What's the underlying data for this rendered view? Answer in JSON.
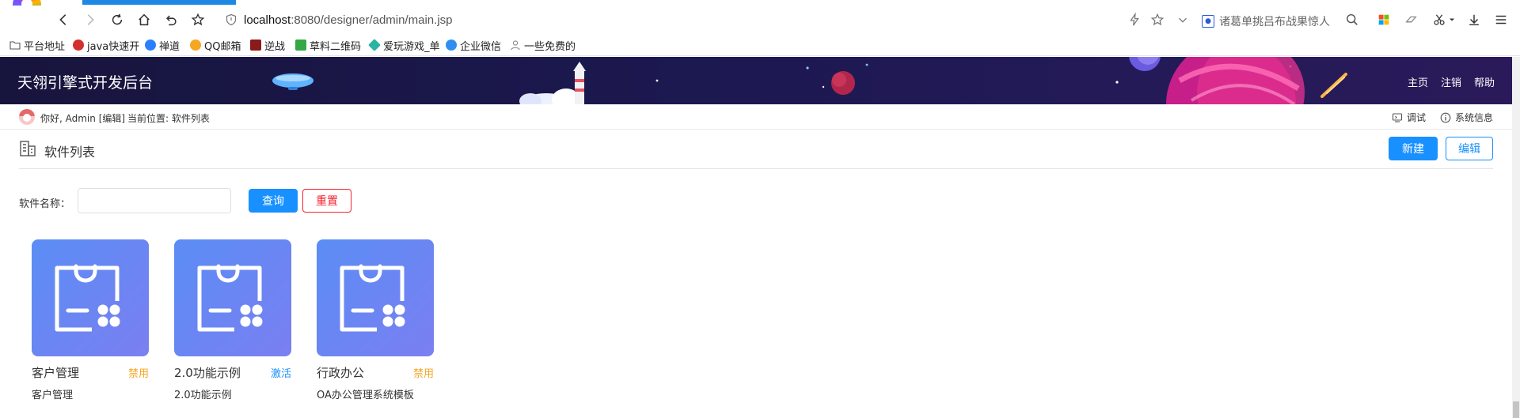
{
  "browser": {
    "address": {
      "host": "localhost",
      "rest": ":8080/designer/admin/main.jsp"
    },
    "search_hint": "诸葛单挑吕布战果惊人",
    "bookmarks": [
      {
        "label": "平台地址",
        "icon_color": "#666666"
      },
      {
        "label": "java快速开",
        "icon_color": "#d32f2f"
      },
      {
        "label": "禅道",
        "icon_color": "#2a7fff"
      },
      {
        "label": "QQ邮箱",
        "icon_color": "#f5a623"
      },
      {
        "label": "逆战",
        "icon_color": "#8b1a1a"
      },
      {
        "label": "草料二维码",
        "icon_color": "#35a845"
      },
      {
        "label": "爱玩游戏_单",
        "icon_color": "#2bb3a3"
      },
      {
        "label": "企业微信",
        "icon_color": "#2f8ef0"
      },
      {
        "label": "一些免费的",
        "icon_color": "#888888"
      }
    ]
  },
  "header": {
    "title": "天翎引擎式开发后台",
    "nav": [
      "主页",
      "注销",
      "帮助"
    ]
  },
  "subbar": {
    "greeting": "你好, Admin",
    "edit_link": "[编辑]",
    "location": "当前位置: 软件列表",
    "debug": "调试",
    "sysinfo": "系统信息"
  },
  "page": {
    "title": "软件列表",
    "new_button": "新建",
    "edit_button": "编辑",
    "filter_label": "软件名称：",
    "filter_value": "",
    "query_button": "查询",
    "reset_button": "重置"
  },
  "colors": {
    "primary": "#1890ff",
    "danger": "#f5222d",
    "status_disabled": "#f5a623",
    "status_active": "#1890ff"
  },
  "apps": [
    {
      "name": "客户管理",
      "status": "禁用",
      "status_color": "#f5a623",
      "desc": "客户管理",
      "icon": "app-bag-icon"
    },
    {
      "name": "2.0功能示例",
      "status": "激活",
      "status_color": "#1890ff",
      "desc": "2.0功能示例",
      "icon": "app-bag-icon"
    },
    {
      "name": "行政办公",
      "status": "禁用",
      "status_color": "#f5a623",
      "desc": "OA办公管理系统模板",
      "icon": "app-bag-icon"
    }
  ]
}
